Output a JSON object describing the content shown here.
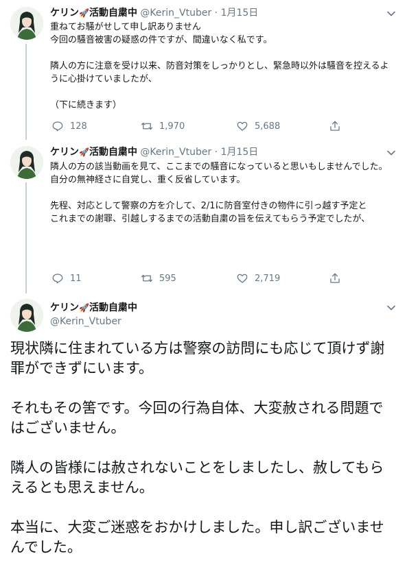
{
  "colors": {
    "accent": "#1da1f2",
    "text": "#14171a",
    "muted": "#657786",
    "thread": "#c4cfd6"
  },
  "tweets": [
    {
      "name": "ケリン",
      "name_suffix": "活動自粛中",
      "handle": "@Kerin_Vtuber",
      "sep": "·",
      "date": "1月15日",
      "text": "重ねてお騒がせして申し訳ありません\n今回の騒音被害の疑惑の件ですが、間違いなく私です。\n\n隣人の方に注意を受け以来、防音対策をしっかりとし、緊急時以外は騒音を控えるように心掛けていましたが、\n\n（下に続きます）",
      "replies": "128",
      "retweets": "1,970",
      "likes": "5,688"
    },
    {
      "name": "ケリン",
      "name_suffix": "活動自粛中",
      "handle": "@Kerin_Vtuber",
      "sep": "·",
      "date": "1月15日",
      "text": "隣人の方の該当動画を見て、ここまでの騒音になっていると思いもしませんでした。\n自分の無神経さに自覚し、重く反省しています。\n\n先程、対応として警察の方を介して、2/1に防音室付きの物件に引っ越す予定と\nこれまでの謝罪、引越しするまでの活動自粛の旨を伝えてもらう予定でしたが、",
      "replies": "11",
      "retweets": "595",
      "likes": "2,719"
    }
  ],
  "main": {
    "name": "ケリン",
    "name_suffix": "活動自粛中",
    "handle": "@Kerin_Vtuber",
    "text": "現状隣に住まれている方は警察の訪問にも応じて頂けず謝罪ができずにいます。\n\nそれもその筈です。今回の行為自体、大変赦される問題ではございません。\n\n隣人の皆様には赦されないことをしましたし、赦してもらえるとも思えません。\n\n本当に、大変ご迷惑をおかけしました。申し訳ございませんでした。"
  },
  "icons": {
    "rocket": "🚀",
    "reply": "reply-icon",
    "retweet": "retweet-icon",
    "like": "heart-icon",
    "share": "share-icon",
    "caret": "chevron-down-icon"
  }
}
